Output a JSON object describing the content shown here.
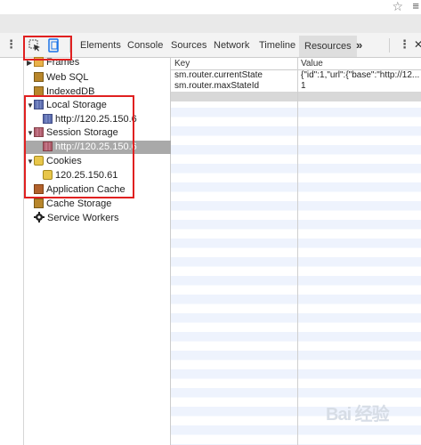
{
  "browser": {
    "bookmark_icon": "star-icon",
    "menu_icon": "menu-icon"
  },
  "toolbar": {
    "tabs": [
      "Elements",
      "Console",
      "Sources",
      "Network",
      "Timeline",
      "Resources"
    ],
    "active_tab": "Resources",
    "more_label": "»",
    "close_label": "✕"
  },
  "sidebar": {
    "frames_label": "Frames",
    "web_sql_label": "Web SQL",
    "indexeddb_label": "IndexedDB",
    "local_storage_label": "Local Storage",
    "local_storage_origin": "http://120.25.150.6",
    "session_storage_label": "Session Storage",
    "session_storage_origin": "http://120.25.150.6",
    "cookies_label": "Cookies",
    "cookies_origin": "120.25.150.61",
    "app_cache_label": "Application Cache",
    "cache_storage_label": "Cache Storage",
    "service_workers_label": "Service Workers"
  },
  "table": {
    "columns": [
      "Key",
      "Value"
    ],
    "rows": [
      {
        "key": "sm.router.currentState",
        "value": "{\"id\":1,\"url\":{\"base\":\"http://12..."
      },
      {
        "key": "sm.router.maxStateId",
        "value": "1"
      }
    ]
  },
  "watermark": "Bai 经验",
  "colors": {
    "highlight": "#e02020",
    "selected_row": "#a9a9a9",
    "stripe": "#eef3fd"
  }
}
